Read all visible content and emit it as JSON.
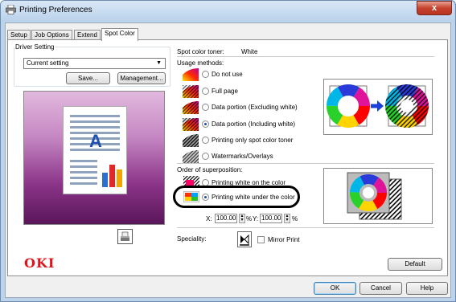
{
  "window": {
    "title": "Printing Preferences",
    "close_label": "x"
  },
  "tabs": [
    {
      "label": "Setup",
      "active": false
    },
    {
      "label": "Job Options",
      "active": false
    },
    {
      "label": "Extend",
      "active": false
    },
    {
      "label": "Spot Color",
      "active": true
    }
  ],
  "driver_setting": {
    "group_label": "Driver Setting",
    "selected": "Current setting",
    "save_label": "Save...",
    "management_label": "Management..."
  },
  "preview": {
    "letter": "A"
  },
  "spot_color": {
    "toner_label": "Spot color toner:",
    "toner_value": "White",
    "usage_label": "Usage methods:",
    "usage_options": [
      {
        "label": "Do not use",
        "selected": false
      },
      {
        "label": "Full page",
        "selected": false
      },
      {
        "label": "Data portion (Excluding white)",
        "selected": false
      },
      {
        "label": "Data portion (Including white)",
        "selected": true
      },
      {
        "label": "Printing only spot color toner",
        "selected": false
      },
      {
        "label": "Watermarks/Overlays",
        "selected": false
      }
    ],
    "order_label": "Order of superposition:",
    "order_options": [
      {
        "label": "Printing white on the color",
        "selected": false
      },
      {
        "label": "Printing white under the color",
        "selected": true
      }
    ],
    "x_scale_label": "X:",
    "x_scale_value": "100.00",
    "x_unit": "%",
    "y_scale_label": "Y:",
    "y_scale_value": "100.00",
    "y_unit": "%",
    "speciality_label": "Speciality:",
    "mirror_label": "Mirror Print",
    "mirror_checked": false
  },
  "brand": {
    "logo_text": "OKI",
    "color": "#e0151c"
  },
  "buttons": {
    "default": "Default",
    "ok": "OK",
    "cancel": "Cancel",
    "help": "Help"
  },
  "colors": {
    "highlight": "#000000",
    "accent": "#1a4ca3"
  }
}
